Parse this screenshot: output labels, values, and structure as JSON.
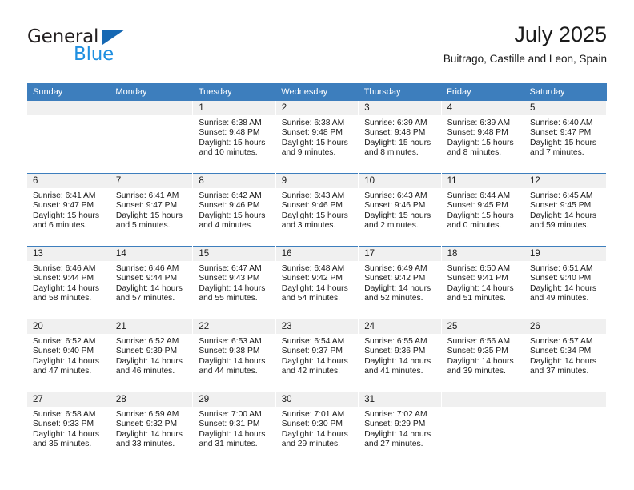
{
  "brand": {
    "name_top": "General",
    "name_bottom": "Blue",
    "triangle_icon": "brand-triangle-icon",
    "color_dark": "#231f20",
    "color_blue": "#1f8fe0",
    "color_triangle": "#1668b3"
  },
  "header": {
    "title": "July 2025",
    "subtitle": "Buitrago, Castille and Leon, Spain"
  },
  "theme": {
    "header_row_bg": "#3d7ebd",
    "daynum_bg": "#f0f0f0",
    "text": "#1a1a1a"
  },
  "weekdays": [
    "Sunday",
    "Monday",
    "Tuesday",
    "Wednesday",
    "Thursday",
    "Friday",
    "Saturday"
  ],
  "weeks": [
    [
      {
        "day": "",
        "blank": true,
        "sunrise": "",
        "sunset": "",
        "daylight_1": "",
        "daylight_2": ""
      },
      {
        "day": "",
        "blank": true,
        "sunrise": "",
        "sunset": "",
        "daylight_1": "",
        "daylight_2": ""
      },
      {
        "day": "1",
        "sunrise": "Sunrise: 6:38 AM",
        "sunset": "Sunset: 9:48 PM",
        "daylight_1": "Daylight: 15 hours",
        "daylight_2": "and 10 minutes."
      },
      {
        "day": "2",
        "sunrise": "Sunrise: 6:38 AM",
        "sunset": "Sunset: 9:48 PM",
        "daylight_1": "Daylight: 15 hours",
        "daylight_2": "and 9 minutes."
      },
      {
        "day": "3",
        "sunrise": "Sunrise: 6:39 AM",
        "sunset": "Sunset: 9:48 PM",
        "daylight_1": "Daylight: 15 hours",
        "daylight_2": "and 8 minutes."
      },
      {
        "day": "4",
        "sunrise": "Sunrise: 6:39 AM",
        "sunset": "Sunset: 9:48 PM",
        "daylight_1": "Daylight: 15 hours",
        "daylight_2": "and 8 minutes."
      },
      {
        "day": "5",
        "sunrise": "Sunrise: 6:40 AM",
        "sunset": "Sunset: 9:47 PM",
        "daylight_1": "Daylight: 15 hours",
        "daylight_2": "and 7 minutes."
      }
    ],
    [
      {
        "day": "6",
        "sunrise": "Sunrise: 6:41 AM",
        "sunset": "Sunset: 9:47 PM",
        "daylight_1": "Daylight: 15 hours",
        "daylight_2": "and 6 minutes."
      },
      {
        "day": "7",
        "sunrise": "Sunrise: 6:41 AM",
        "sunset": "Sunset: 9:47 PM",
        "daylight_1": "Daylight: 15 hours",
        "daylight_2": "and 5 minutes."
      },
      {
        "day": "8",
        "sunrise": "Sunrise: 6:42 AM",
        "sunset": "Sunset: 9:46 PM",
        "daylight_1": "Daylight: 15 hours",
        "daylight_2": "and 4 minutes."
      },
      {
        "day": "9",
        "sunrise": "Sunrise: 6:43 AM",
        "sunset": "Sunset: 9:46 PM",
        "daylight_1": "Daylight: 15 hours",
        "daylight_2": "and 3 minutes."
      },
      {
        "day": "10",
        "sunrise": "Sunrise: 6:43 AM",
        "sunset": "Sunset: 9:46 PM",
        "daylight_1": "Daylight: 15 hours",
        "daylight_2": "and 2 minutes."
      },
      {
        "day": "11",
        "sunrise": "Sunrise: 6:44 AM",
        "sunset": "Sunset: 9:45 PM",
        "daylight_1": "Daylight: 15 hours",
        "daylight_2": "and 0 minutes."
      },
      {
        "day": "12",
        "sunrise": "Sunrise: 6:45 AM",
        "sunset": "Sunset: 9:45 PM",
        "daylight_1": "Daylight: 14 hours",
        "daylight_2": "and 59 minutes."
      }
    ],
    [
      {
        "day": "13",
        "sunrise": "Sunrise: 6:46 AM",
        "sunset": "Sunset: 9:44 PM",
        "daylight_1": "Daylight: 14 hours",
        "daylight_2": "and 58 minutes."
      },
      {
        "day": "14",
        "sunrise": "Sunrise: 6:46 AM",
        "sunset": "Sunset: 9:44 PM",
        "daylight_1": "Daylight: 14 hours",
        "daylight_2": "and 57 minutes."
      },
      {
        "day": "15",
        "sunrise": "Sunrise: 6:47 AM",
        "sunset": "Sunset: 9:43 PM",
        "daylight_1": "Daylight: 14 hours",
        "daylight_2": "and 55 minutes."
      },
      {
        "day": "16",
        "sunrise": "Sunrise: 6:48 AM",
        "sunset": "Sunset: 9:42 PM",
        "daylight_1": "Daylight: 14 hours",
        "daylight_2": "and 54 minutes."
      },
      {
        "day": "17",
        "sunrise": "Sunrise: 6:49 AM",
        "sunset": "Sunset: 9:42 PM",
        "daylight_1": "Daylight: 14 hours",
        "daylight_2": "and 52 minutes."
      },
      {
        "day": "18",
        "sunrise": "Sunrise: 6:50 AM",
        "sunset": "Sunset: 9:41 PM",
        "daylight_1": "Daylight: 14 hours",
        "daylight_2": "and 51 minutes."
      },
      {
        "day": "19",
        "sunrise": "Sunrise: 6:51 AM",
        "sunset": "Sunset: 9:40 PM",
        "daylight_1": "Daylight: 14 hours",
        "daylight_2": "and 49 minutes."
      }
    ],
    [
      {
        "day": "20",
        "sunrise": "Sunrise: 6:52 AM",
        "sunset": "Sunset: 9:40 PM",
        "daylight_1": "Daylight: 14 hours",
        "daylight_2": "and 47 minutes."
      },
      {
        "day": "21",
        "sunrise": "Sunrise: 6:52 AM",
        "sunset": "Sunset: 9:39 PM",
        "daylight_1": "Daylight: 14 hours",
        "daylight_2": "and 46 minutes."
      },
      {
        "day": "22",
        "sunrise": "Sunrise: 6:53 AM",
        "sunset": "Sunset: 9:38 PM",
        "daylight_1": "Daylight: 14 hours",
        "daylight_2": "and 44 minutes."
      },
      {
        "day": "23",
        "sunrise": "Sunrise: 6:54 AM",
        "sunset": "Sunset: 9:37 PM",
        "daylight_1": "Daylight: 14 hours",
        "daylight_2": "and 42 minutes."
      },
      {
        "day": "24",
        "sunrise": "Sunrise: 6:55 AM",
        "sunset": "Sunset: 9:36 PM",
        "daylight_1": "Daylight: 14 hours",
        "daylight_2": "and 41 minutes."
      },
      {
        "day": "25",
        "sunrise": "Sunrise: 6:56 AM",
        "sunset": "Sunset: 9:35 PM",
        "daylight_1": "Daylight: 14 hours",
        "daylight_2": "and 39 minutes."
      },
      {
        "day": "26",
        "sunrise": "Sunrise: 6:57 AM",
        "sunset": "Sunset: 9:34 PM",
        "daylight_1": "Daylight: 14 hours",
        "daylight_2": "and 37 minutes."
      }
    ],
    [
      {
        "day": "27",
        "sunrise": "Sunrise: 6:58 AM",
        "sunset": "Sunset: 9:33 PM",
        "daylight_1": "Daylight: 14 hours",
        "daylight_2": "and 35 minutes."
      },
      {
        "day": "28",
        "sunrise": "Sunrise: 6:59 AM",
        "sunset": "Sunset: 9:32 PM",
        "daylight_1": "Daylight: 14 hours",
        "daylight_2": "and 33 minutes."
      },
      {
        "day": "29",
        "sunrise": "Sunrise: 7:00 AM",
        "sunset": "Sunset: 9:31 PM",
        "daylight_1": "Daylight: 14 hours",
        "daylight_2": "and 31 minutes."
      },
      {
        "day": "30",
        "sunrise": "Sunrise: 7:01 AM",
        "sunset": "Sunset: 9:30 PM",
        "daylight_1": "Daylight: 14 hours",
        "daylight_2": "and 29 minutes."
      },
      {
        "day": "31",
        "sunrise": "Sunrise: 7:02 AM",
        "sunset": "Sunset: 9:29 PM",
        "daylight_1": "Daylight: 14 hours",
        "daylight_2": "and 27 minutes."
      },
      {
        "day": "",
        "blank": true,
        "sunrise": "",
        "sunset": "",
        "daylight_1": "",
        "daylight_2": ""
      },
      {
        "day": "",
        "blank": true,
        "sunrise": "",
        "sunset": "",
        "daylight_1": "",
        "daylight_2": ""
      }
    ]
  ]
}
